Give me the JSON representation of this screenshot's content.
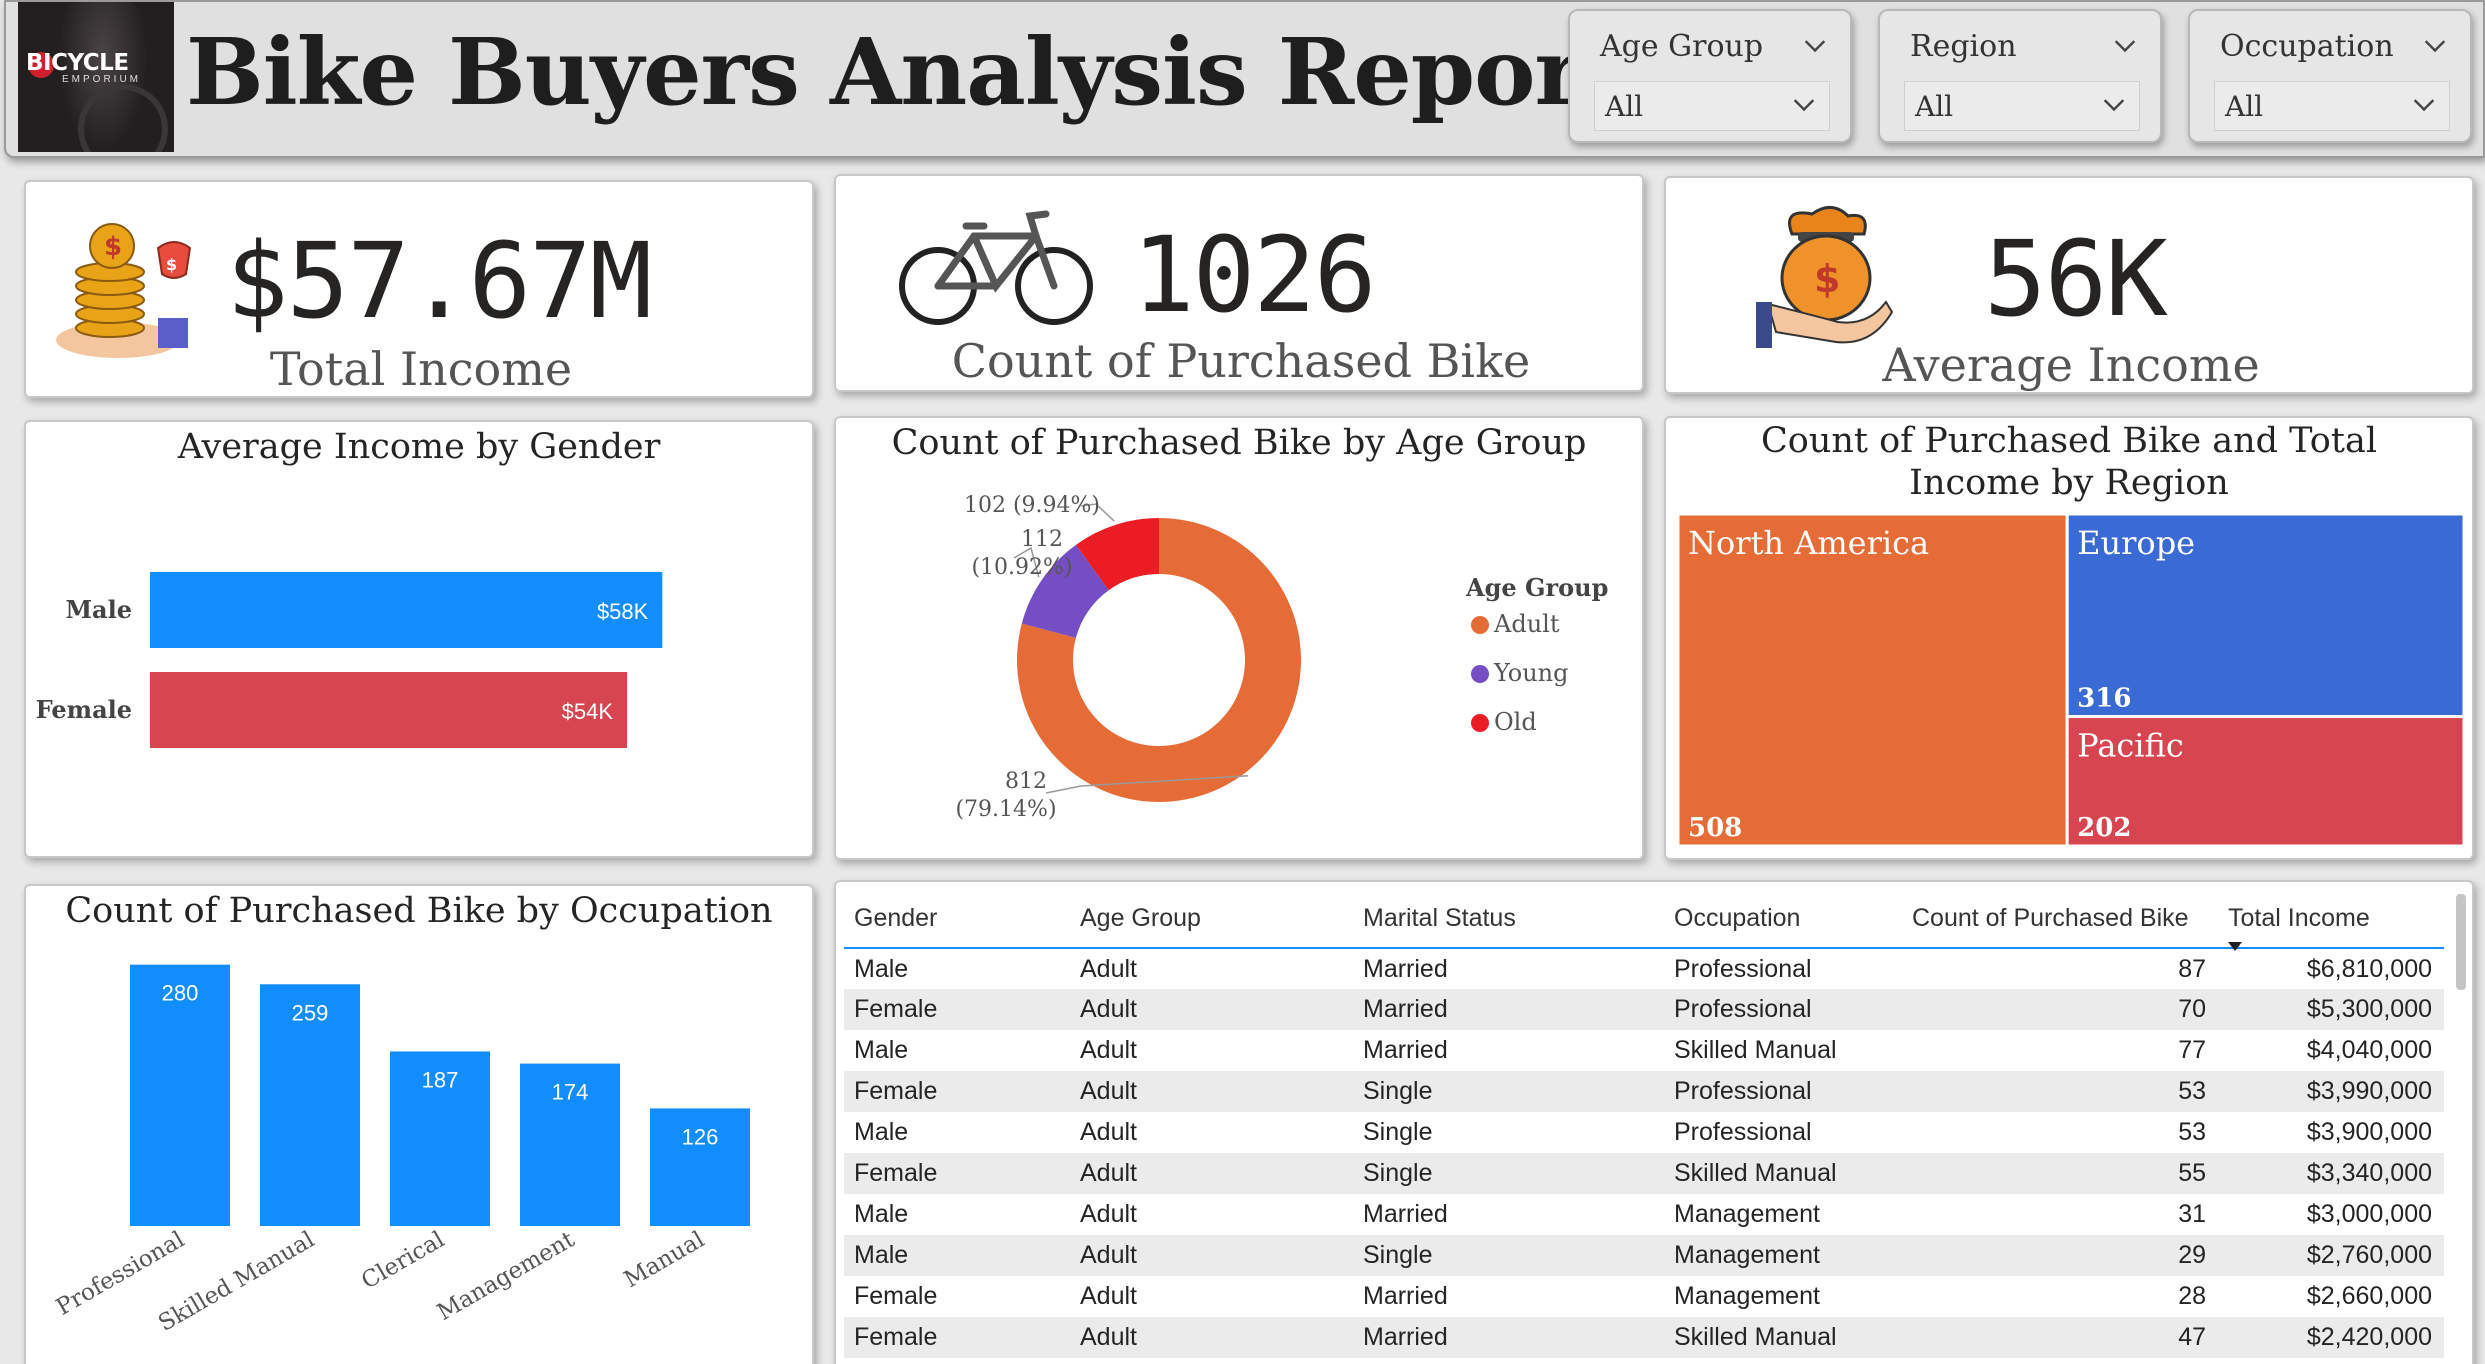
{
  "header": {
    "title": "Bike Buyers Analysis Report",
    "logo_text": "BICYCLE",
    "logo_sub": "EMPORIUM"
  },
  "slicers": [
    {
      "label": "Age Group",
      "value": "All"
    },
    {
      "label": "Region",
      "value": "All"
    },
    {
      "label": "Occupation",
      "value": "All"
    }
  ],
  "kpis": {
    "total_income": {
      "value": "$57.67M",
      "label": "Total Income",
      "icon": "money-coins-icon"
    },
    "count_bikes": {
      "value": "1026",
      "label": "Count of Purchased Bike",
      "icon": "bicycle-icon"
    },
    "avg_income": {
      "value": "56K",
      "label": "Average Income",
      "icon": "money-bag-hand-icon"
    }
  },
  "colors": {
    "blue": "#118dff",
    "red": "#d64550",
    "orange": "#e66c37",
    "purple": "#744ec2",
    "bright_red": "#eb1c24",
    "treemap_blue": "#3a6ad4",
    "treemap_orange": "#e66c37",
    "treemap_red": "#d64550"
  },
  "chart_data": [
    {
      "type": "bar",
      "orientation": "horizontal",
      "title": "Average Income by Gender",
      "categories": [
        "Male",
        "Female"
      ],
      "values": [
        58000,
        54000
      ],
      "data_labels": [
        "$58K",
        "$54K"
      ],
      "xlim": [
        0,
        60000
      ]
    },
    {
      "type": "pie",
      "donut": true,
      "title": "Count of Purchased Bike by Age Group",
      "legend_title": "Age Group",
      "legend_position": "right",
      "categories": [
        "Adult",
        "Young",
        "Old"
      ],
      "values": [
        812,
        112,
        102
      ],
      "data_labels": [
        "812 (79.14%)",
        "112 (10.92%)",
        "102 (9.94%)"
      ]
    },
    {
      "type": "treemap",
      "title": "Count of Purchased Bike and Total Income by Region",
      "categories": [
        "North America",
        "Europe",
        "Pacific"
      ],
      "values": [
        508,
        316,
        202
      ]
    },
    {
      "type": "bar",
      "title": "Count of Purchased Bike by Occupation",
      "categories": [
        "Professional",
        "Skilled Manual",
        "Clerical",
        "Management",
        "Manual"
      ],
      "values": [
        280,
        259,
        187,
        174,
        126
      ],
      "ylim": [
        0,
        300
      ]
    },
    {
      "type": "table",
      "columns": [
        "Gender",
        "Age Group",
        "Marital Status",
        "Occupation",
        "Count of Purchased Bike",
        "Total Income"
      ],
      "sort": {
        "column": "Total Income",
        "direction": "descending"
      },
      "rows": [
        [
          "Male",
          "Adult",
          "Married",
          "Professional",
          "87",
          "$6,810,000"
        ],
        [
          "Female",
          "Adult",
          "Married",
          "Professional",
          "70",
          "$5,300,000"
        ],
        [
          "Male",
          "Adult",
          "Married",
          "Skilled Manual",
          "77",
          "$4,040,000"
        ],
        [
          "Female",
          "Adult",
          "Single",
          "Professional",
          "53",
          "$3,990,000"
        ],
        [
          "Male",
          "Adult",
          "Single",
          "Professional",
          "53",
          "$3,900,000"
        ],
        [
          "Female",
          "Adult",
          "Single",
          "Skilled Manual",
          "55",
          "$3,340,000"
        ],
        [
          "Male",
          "Adult",
          "Married",
          "Management",
          "31",
          "$3,000,000"
        ],
        [
          "Male",
          "Adult",
          "Single",
          "Management",
          "29",
          "$2,760,000"
        ],
        [
          "Female",
          "Adult",
          "Married",
          "Management",
          "28",
          "$2,660,000"
        ],
        [
          "Female",
          "Adult",
          "Married",
          "Skilled Manual",
          "47",
          "$2,420,000"
        ]
      ]
    }
  ]
}
